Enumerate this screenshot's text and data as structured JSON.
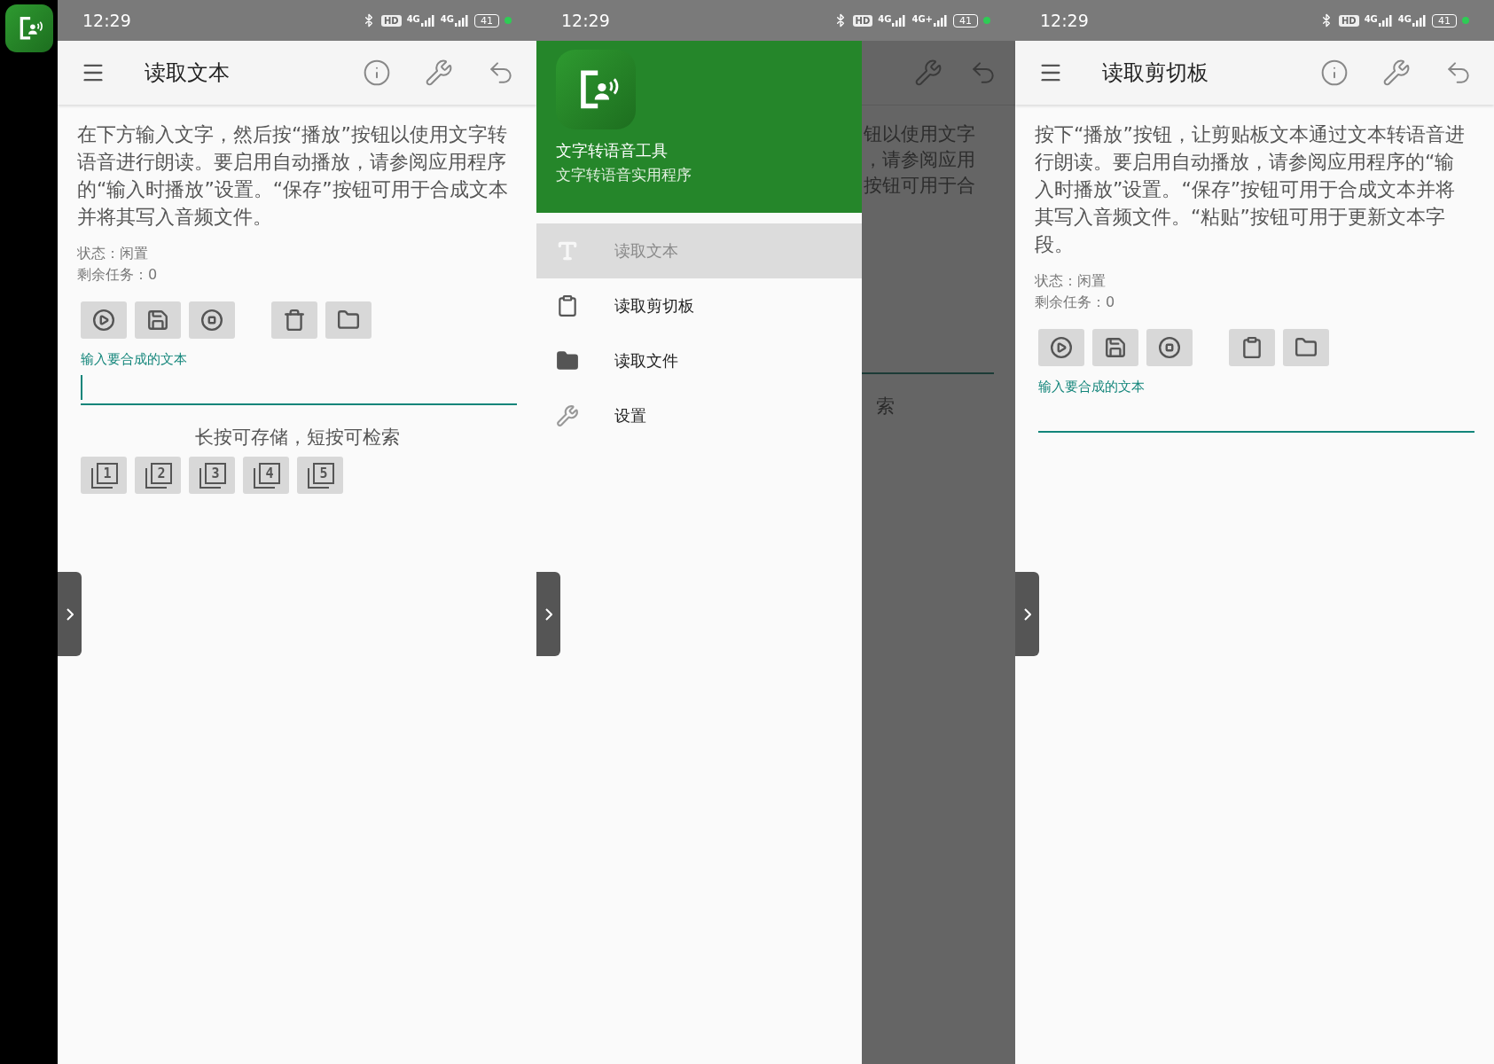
{
  "screens": [
    {
      "kind": "reader",
      "status_bar": {
        "time": "12:29",
        "hd": "HD",
        "networks": [
          "4G",
          "4G"
        ],
        "battery": "41"
      },
      "title": "读取文本",
      "description": "在下方输入文字，然后按“播放”按钮以使用文字转语音进行朗读。要启用自动播放，请参阅应用程序的“输入时播放”设置。“保存”按钮可用于合成文本并将其写入音频文件。",
      "status": "状态：闲置",
      "tasks": "剩余任务：0",
      "actions": [
        {
          "kind": "play"
        },
        {
          "kind": "save"
        },
        {
          "kind": "stop"
        },
        {
          "kind": "delete"
        },
        {
          "kind": "folder"
        }
      ],
      "field": {
        "label": "输入要合成的文本",
        "focused": true
      },
      "memory": {
        "hint": "长按可存储，短按可检索",
        "slots": [
          "1",
          "2",
          "3",
          "4",
          "5"
        ]
      }
    },
    {
      "kind": "drawer",
      "status_bar": {
        "time": "12:29",
        "hd": "HD",
        "networks": [
          "4G",
          "4G+"
        ],
        "battery": "41"
      },
      "header": {
        "title": "文字转语音工具",
        "subtitle": "文字转语音实用程序"
      },
      "menu": [
        {
          "kind": "text",
          "label": "读取文本",
          "selected": true
        },
        {
          "kind": "clipboard",
          "label": "读取剪切板",
          "selected": false
        },
        {
          "kind": "folder",
          "label": "读取文件",
          "selected": false
        },
        {
          "kind": "settings",
          "label": "设置",
          "selected": false
        }
      ],
      "behind": {
        "lines": [
          "钮以使用文字",
          "，请参阅应用",
          "按钮可用于合"
        ],
        "hint": "索"
      }
    },
    {
      "kind": "reader",
      "status_bar": {
        "time": "12:29",
        "hd": "HD",
        "networks": [
          "4G",
          "4G"
        ],
        "battery": "41"
      },
      "title": "读取剪切板",
      "description": "按下“播放”按钮，让剪贴板文本通过文本转语音进行朗读。要启用自动播放，请参阅应用程序的“输入时播放”设置。“保存”按钮可用于合成文本并将其写入音频文件。“粘贴”按钮可用于更新文本字段。",
      "status": "状态：闲置",
      "tasks": "剩余任务：0",
      "actions": [
        {
          "kind": "play"
        },
        {
          "kind": "save"
        },
        {
          "kind": "stop"
        },
        {
          "kind": "paste"
        },
        {
          "kind": "folder"
        }
      ],
      "field": {
        "label": "输入要合成的文本",
        "focused": false
      }
    }
  ]
}
